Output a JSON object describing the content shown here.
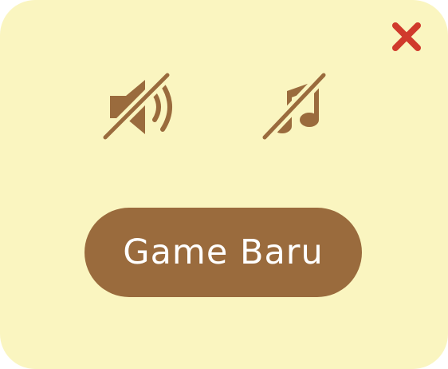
{
  "dialog": {
    "background_color": "#faf5c0",
    "accent_color": "#9a6b3d",
    "close_color": "#d03a2c"
  },
  "close_button": {
    "icon": "close-icon"
  },
  "sound_toggle": {
    "icon": "speaker-muted-icon",
    "state": "off"
  },
  "music_toggle": {
    "icon": "music-note-muted-icon",
    "state": "off"
  },
  "new_game_button": {
    "label": "Game Baru"
  }
}
